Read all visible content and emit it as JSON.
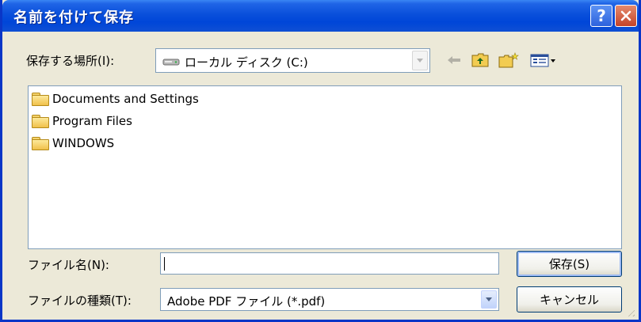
{
  "window": {
    "title": "名前を付けて保存",
    "help_label": "?"
  },
  "location": {
    "label": "保存する場所(I):",
    "value": "ローカル ディスク (C:)",
    "drive_icon": "drive-icon"
  },
  "toolbar": {
    "back_icon": "back-arrow-icon",
    "up_icon": "up-folder-icon",
    "new_folder_icon": "new-folder-icon",
    "view_icon": "view-menu-icon"
  },
  "files": [
    {
      "name": "Documents and Settings",
      "icon": "folder-icon"
    },
    {
      "name": "Program Files",
      "icon": "folder-icon"
    },
    {
      "name": "WINDOWS",
      "icon": "folder-icon"
    }
  ],
  "filename": {
    "label": "ファイル名(N):",
    "value": ""
  },
  "filetype": {
    "label": "ファイルの種類(T):",
    "value": "Adobe PDF ファイル (*.pdf)"
  },
  "buttons": {
    "save": "保存(S)",
    "cancel": "キャンセル"
  }
}
